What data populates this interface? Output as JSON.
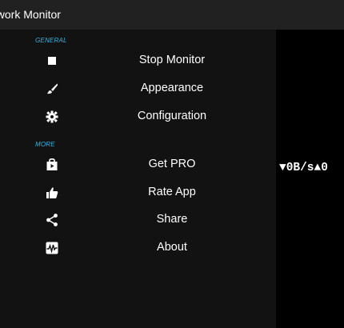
{
  "app": {
    "title": "Network Monitor"
  },
  "drawer": {
    "sections": [
      {
        "header": "GENERAL",
        "items": [
          {
            "label": "Stop Monitor",
            "icon": "stop-icon"
          },
          {
            "label": "Appearance",
            "icon": "paintbrush-icon"
          },
          {
            "label": "Configuration",
            "icon": "gear-icon"
          }
        ]
      },
      {
        "header": "MORE",
        "items": [
          {
            "label": "Get PRO",
            "icon": "store-bag-icon"
          },
          {
            "label": "Rate App",
            "icon": "thumbs-up-icon"
          },
          {
            "label": "Share",
            "icon": "share-icon"
          },
          {
            "label": "About",
            "icon": "pulse-icon"
          }
        ]
      }
    ]
  },
  "speed_widget": {
    "text": "▼0B/s▲0"
  },
  "colors": {
    "app_bar": "#212121",
    "drawer_bg": "#121212",
    "section_header": "#33b5e5",
    "text": "#ffffff"
  }
}
